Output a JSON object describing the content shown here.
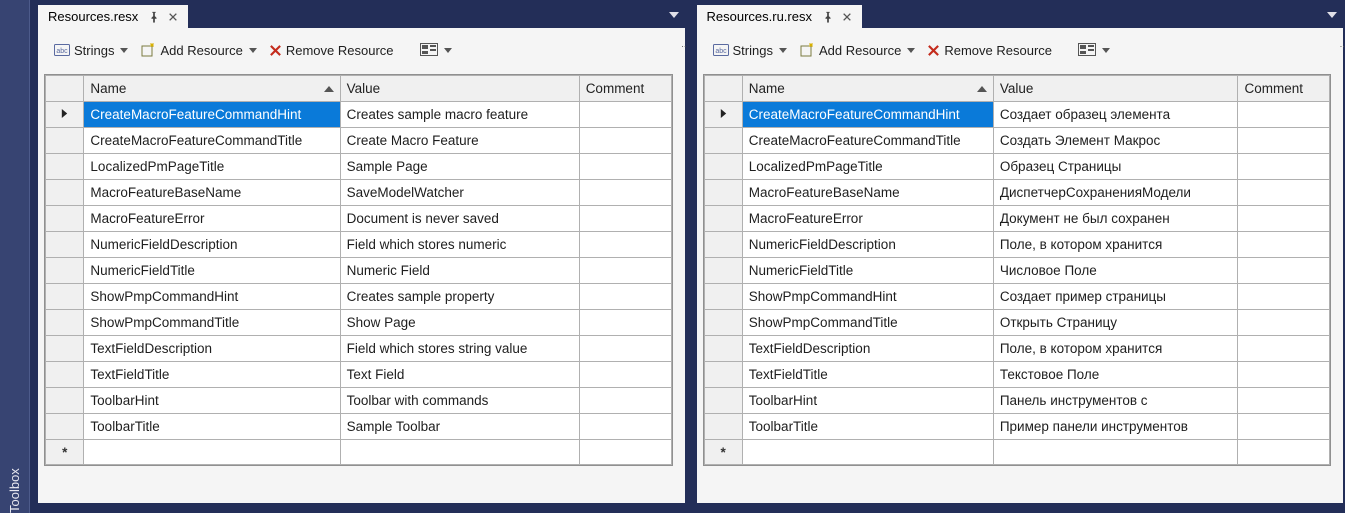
{
  "toolbox": {
    "label": "Toolbox"
  },
  "toolbar": {
    "strings": "Strings",
    "addResource": "Add Resource",
    "removeResource": "Remove Resource"
  },
  "columns": {
    "name": "Name",
    "value": "Value",
    "comment": "Comment"
  },
  "panes": [
    {
      "tab": "Resources.resx",
      "rows": [
        {
          "name": "CreateMacroFeatureCommandHint",
          "value": "Creates sample macro feature",
          "comment": ""
        },
        {
          "name": "CreateMacroFeatureCommandTitle",
          "value": "Create Macro Feature",
          "comment": ""
        },
        {
          "name": "LocalizedPmPageTitle",
          "value": "Sample Page",
          "comment": ""
        },
        {
          "name": "MacroFeatureBaseName",
          "value": "SaveModelWatcher",
          "comment": ""
        },
        {
          "name": "MacroFeatureError",
          "value": "Document is never saved",
          "comment": ""
        },
        {
          "name": "NumericFieldDescription",
          "value": "Field which stores numeric",
          "comment": ""
        },
        {
          "name": "NumericFieldTitle",
          "value": "Numeric Field",
          "comment": ""
        },
        {
          "name": "ShowPmpCommandHint",
          "value": "Creates sample property",
          "comment": ""
        },
        {
          "name": "ShowPmpCommandTitle",
          "value": "Show Page",
          "comment": ""
        },
        {
          "name": "TextFieldDescription",
          "value": "Field which stores string value",
          "comment": ""
        },
        {
          "name": "TextFieldTitle",
          "value": "Text Field",
          "comment": ""
        },
        {
          "name": "ToolbarHint",
          "value": "Toolbar with commands",
          "comment": ""
        },
        {
          "name": "ToolbarTitle",
          "value": "Sample Toolbar",
          "comment": ""
        }
      ]
    },
    {
      "tab": "Resources.ru.resx",
      "rows": [
        {
          "name": "CreateMacroFeatureCommandHint",
          "value": "Создает образец элемента",
          "comment": ""
        },
        {
          "name": "CreateMacroFeatureCommandTitle",
          "value": "Создать Элемент Макрос",
          "comment": ""
        },
        {
          "name": "LocalizedPmPageTitle",
          "value": "Образец Страницы",
          "comment": ""
        },
        {
          "name": "MacroFeatureBaseName",
          "value": "ДиспетчерСохраненияМодели",
          "comment": ""
        },
        {
          "name": "MacroFeatureError",
          "value": "Документ не был сохранен",
          "comment": ""
        },
        {
          "name": "NumericFieldDescription",
          "value": "Поле, в котором хранится",
          "comment": ""
        },
        {
          "name": "NumericFieldTitle",
          "value": "Числовое Поле",
          "comment": ""
        },
        {
          "name": "ShowPmpCommandHint",
          "value": "Создает пример страницы",
          "comment": ""
        },
        {
          "name": "ShowPmpCommandTitle",
          "value": "Открыть Страницу",
          "comment": ""
        },
        {
          "name": "TextFieldDescription",
          "value": "Поле, в котором хранится",
          "comment": ""
        },
        {
          "name": "TextFieldTitle",
          "value": "Текстовое Поле",
          "comment": ""
        },
        {
          "name": "ToolbarHint",
          "value": "Панель инструментов с",
          "comment": ""
        },
        {
          "name": "ToolbarTitle",
          "value": "Пример панели инструментов",
          "comment": ""
        }
      ]
    }
  ]
}
